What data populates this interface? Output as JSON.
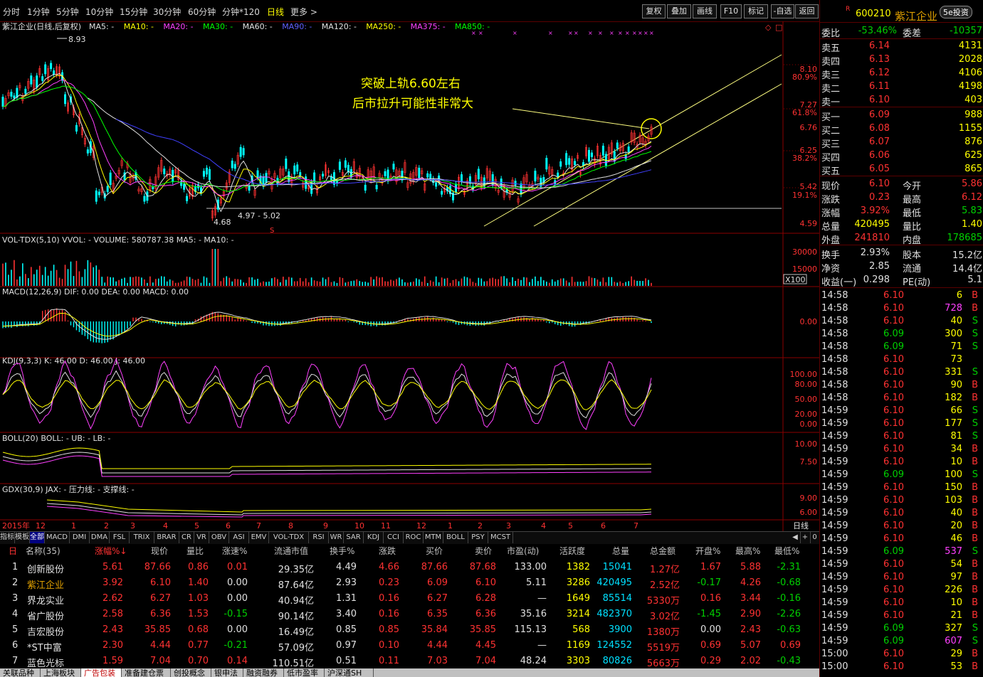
{
  "toolbar": {
    "periods": [
      "分时",
      "1分钟",
      "5分钟",
      "10分钟",
      "15分钟",
      "30分钟",
      "60分钟",
      "分钟*120",
      "日线",
      "更多 >"
    ],
    "active_period": "日线",
    "buttons": [
      "复权",
      "叠加",
      "画线",
      "F10",
      "标记",
      "-自选",
      "返回"
    ]
  },
  "chart": {
    "title": "紫江企业(日线,后复权)",
    "ma_items": [
      {
        "t": "MA5: -",
        "c": "#e0e0e0"
      },
      {
        "t": "MA10: -",
        "c": "#ffff00"
      },
      {
        "t": "MA20: -",
        "c": "#ff40ff"
      },
      {
        "t": "MA30: -",
        "c": "#00ff00"
      },
      {
        "t": "MA60: -",
        "c": "#e0e0e0"
      },
      {
        "t": "MA90: -",
        "c": "#6060ff"
      },
      {
        "t": "MA120: -",
        "c": "#e0e0e0"
      },
      {
        "t": "MA250: -",
        "c": "#ffff00"
      },
      {
        "t": "MA375: -",
        "c": "#ff40ff"
      },
      {
        "t": "MA850: -",
        "c": "#00ff00"
      }
    ],
    "price_axis": [
      "8.10",
      "7.27",
      "6.76",
      "6.25",
      "5.42",
      "4.59"
    ],
    "pct_axis": [
      "80.9%",
      "61.8%",
      "38.2%",
      "19.1%"
    ],
    "high_label": "8.93",
    "low_label": "4.68",
    "range_label": "4.97 - 5.02",
    "s_marker": "S",
    "annotation_line1": "突破上轨6.60左右",
    "annotation_line2": "后市拉升可能性非常大",
    "vol_title": "VOL-TDX(5,10)  VVOL: -   VOLUME: 580787.38  MA5: -  MA10: -",
    "vol_axis": [
      "30000",
      "15000"
    ],
    "vol_unit": "X100",
    "macd_title": "MACD(12,26,9)  DIF: 0.00  DEA: 0.00  MACD: 0.00",
    "macd_axis": "0.00",
    "kdj_title": "KDJ(9,3,3)  K: 46.00  D: 46.00  J: 46.00",
    "kdj_axis": [
      "100.00",
      "80.00",
      "50.00",
      "20.00",
      "0.00"
    ],
    "boll_title": "BOLL(20)  BOLL: -  UB: -  LB: -",
    "boll_axis": [
      "10.00",
      "7.50"
    ],
    "gdx_title": "GDX(30,9)  JAX: -  压力线: -  支撑线: -",
    "gdx_axis": [
      "9.00",
      "6.00"
    ],
    "x_axis": [
      "2015年",
      "12",
      "1",
      "2",
      "3",
      "4",
      "5",
      "6",
      "7",
      "8",
      "9",
      "10",
      "11",
      "12",
      "1",
      "2",
      "3",
      "4",
      "5",
      "6",
      "7"
    ],
    "x_unit": "日线"
  },
  "indicator_tabs": [
    "指标",
    "模板",
    "全部",
    "MACD",
    "DMI",
    "DMA",
    "FSL",
    "TRIX",
    "BRAR",
    "CR",
    "VR",
    "OBV",
    "ASI",
    "EMV",
    "VOL-TDX",
    "RSI",
    "WR",
    "SAR",
    "KDJ",
    "CCI",
    "ROC",
    "MTM",
    "BOLL",
    "PSY",
    "MCST"
  ],
  "table": {
    "headers": [
      "名称(35)",
      "涨幅%↓",
      "现价",
      "量比",
      "涨速%",
      "流通市值",
      "换手%",
      "涨跌",
      "买价",
      "卖价",
      "市盈(动)",
      "活跃度",
      "总量",
      "总金额",
      "开盘%",
      "最高%",
      "最低%"
    ],
    "rows": [
      [
        "1",
        "创新股份",
        "5.61",
        "87.66",
        "0.86",
        "0.01",
        "29.35亿",
        "4.49",
        "4.66",
        "87.66",
        "87.68",
        "133.00",
        "1382",
        "15041",
        "1.27亿",
        "1.67",
        "5.88",
        "-2.31"
      ],
      [
        "2",
        "紫江企业",
        "3.92",
        "6.10",
        "1.40",
        "0.00",
        "87.64亿",
        "2.93",
        "0.23",
        "6.09",
        "6.10",
        "5.11",
        "3286",
        "420495",
        "2.52亿",
        "-0.17",
        "4.26",
        "-0.68"
      ],
      [
        "3",
        "界龙实业",
        "2.62",
        "6.27",
        "1.03",
        "0.00",
        "40.94亿",
        "1.31",
        "0.16",
        "6.27",
        "6.28",
        "—",
        "1649",
        "85514",
        "5330万",
        "0.16",
        "3.44",
        "-0.16"
      ],
      [
        "4",
        "省广股份",
        "2.58",
        "6.36",
        "1.53",
        "-0.15",
        "90.14亿",
        "3.40",
        "0.16",
        "6.35",
        "6.36",
        "35.16",
        "3214",
        "482370",
        "3.02亿",
        "-1.45",
        "2.90",
        "-2.26"
      ],
      [
        "5",
        "吉宏股份",
        "2.43",
        "35.85",
        "0.68",
        "0.00",
        "16.49亿",
        "0.85",
        "0.85",
        "35.84",
        "35.85",
        "115.13",
        "568",
        "3900",
        "1380万",
        "0.00",
        "2.43",
        "-0.63"
      ],
      [
        "6",
        "*ST中富",
        "2.30",
        "4.44",
        "0.77",
        "-0.21",
        "57.09亿",
        "0.97",
        "0.10",
        "4.44",
        "4.45",
        "—",
        "1169",
        "124552",
        "5519万",
        "0.69",
        "5.07",
        "0.69"
      ],
      [
        "7",
        "蓝色光标",
        "1.59",
        "7.04",
        "0.70",
        "0.14",
        "110.51亿",
        "0.51",
        "0.11",
        "7.03",
        "7.04",
        "48.24",
        "3303",
        "80826",
        "5663万",
        "0.29",
        "2.02",
        "-0.43"
      ]
    ]
  },
  "bottom_tabs": [
    "关联品种",
    "上海板块",
    "广告包装",
    "准备建仓票",
    "创投概念",
    "银申法",
    "融资融券",
    "低市盈率",
    "沪深通SH"
  ],
  "bottom_active": "广告包装",
  "quote": {
    "code": "600210",
    "name": "紫江企业",
    "logo": "5e投资",
    "wb_label": "委比",
    "wb_value": "-53.46%",
    "wc_label": "委差",
    "wc_value": "-10357",
    "asks": [
      [
        "卖五",
        "6.14",
        "4131"
      ],
      [
        "卖四",
        "6.13",
        "2028"
      ],
      [
        "卖三",
        "6.12",
        "4106"
      ],
      [
        "卖二",
        "6.11",
        "4198"
      ],
      [
        "卖一",
        "6.10",
        "403"
      ]
    ],
    "bids": [
      [
        "买一",
        "6.09",
        "988"
      ],
      [
        "买二",
        "6.08",
        "1155"
      ],
      [
        "买三",
        "6.07",
        "876"
      ],
      [
        "买四",
        "6.06",
        "625"
      ],
      [
        "买五",
        "6.05",
        "865"
      ]
    ],
    "stats": [
      [
        "现价",
        "6.10",
        "今开",
        "5.86"
      ],
      [
        "涨跌",
        "0.23",
        "最高",
        "6.12"
      ],
      [
        "涨幅",
        "3.92%",
        "最低",
        "5.83"
      ],
      [
        "总量",
        "420495",
        "量比",
        "1.40"
      ],
      [
        "外盘",
        "241810",
        "内盘",
        "178685"
      ]
    ],
    "stats2": [
      [
        "换手",
        "2.93%",
        "股本",
        "15.2亿"
      ],
      [
        "净资",
        "2.85",
        "流通",
        "14.4亿"
      ],
      [
        "收益(一)",
        "0.298",
        "PE(动)",
        "5.1"
      ]
    ]
  },
  "ticks": [
    [
      "14:58",
      "6.10",
      "6",
      "B"
    ],
    [
      "14:58",
      "6.10",
      "728",
      "B"
    ],
    [
      "14:58",
      "6.10",
      "40",
      "S"
    ],
    [
      "14:58",
      "6.09",
      "300",
      "S"
    ],
    [
      "14:58",
      "6.09",
      "71",
      "S"
    ],
    [
      "14:58",
      "6.10",
      "73",
      ""
    ],
    [
      "14:58",
      "6.10",
      "331",
      "S"
    ],
    [
      "14:58",
      "6.10",
      "90",
      "B"
    ],
    [
      "14:58",
      "6.10",
      "182",
      "B"
    ],
    [
      "14:59",
      "6.10",
      "66",
      "S"
    ],
    [
      "14:59",
      "6.10",
      "177",
      "S"
    ],
    [
      "14:59",
      "6.10",
      "81",
      "S"
    ],
    [
      "14:59",
      "6.10",
      "34",
      "B"
    ],
    [
      "14:59",
      "6.10",
      "10",
      "B"
    ],
    [
      "14:59",
      "6.09",
      "100",
      "S"
    ],
    [
      "14:59",
      "6.10",
      "150",
      "B"
    ],
    [
      "14:59",
      "6.10",
      "103",
      "B"
    ],
    [
      "14:59",
      "6.10",
      "40",
      "B"
    ],
    [
      "14:59",
      "6.10",
      "20",
      "B"
    ],
    [
      "14:59",
      "6.10",
      "46",
      "B"
    ],
    [
      "14:59",
      "6.09",
      "537",
      "S"
    ],
    [
      "14:59",
      "6.10",
      "54",
      "B"
    ],
    [
      "14:59",
      "6.10",
      "97",
      "B"
    ],
    [
      "14:59",
      "6.10",
      "226",
      "B"
    ],
    [
      "14:59",
      "6.10",
      "10",
      "B"
    ],
    [
      "14:59",
      "6.10",
      "21",
      "B"
    ],
    [
      "14:59",
      "6.09",
      "327",
      "S"
    ],
    [
      "14:59",
      "6.09",
      "607",
      "S"
    ],
    [
      "15:00",
      "6.10",
      "29",
      "B"
    ],
    [
      "15:00",
      "6.10",
      "53",
      "B"
    ]
  ]
}
